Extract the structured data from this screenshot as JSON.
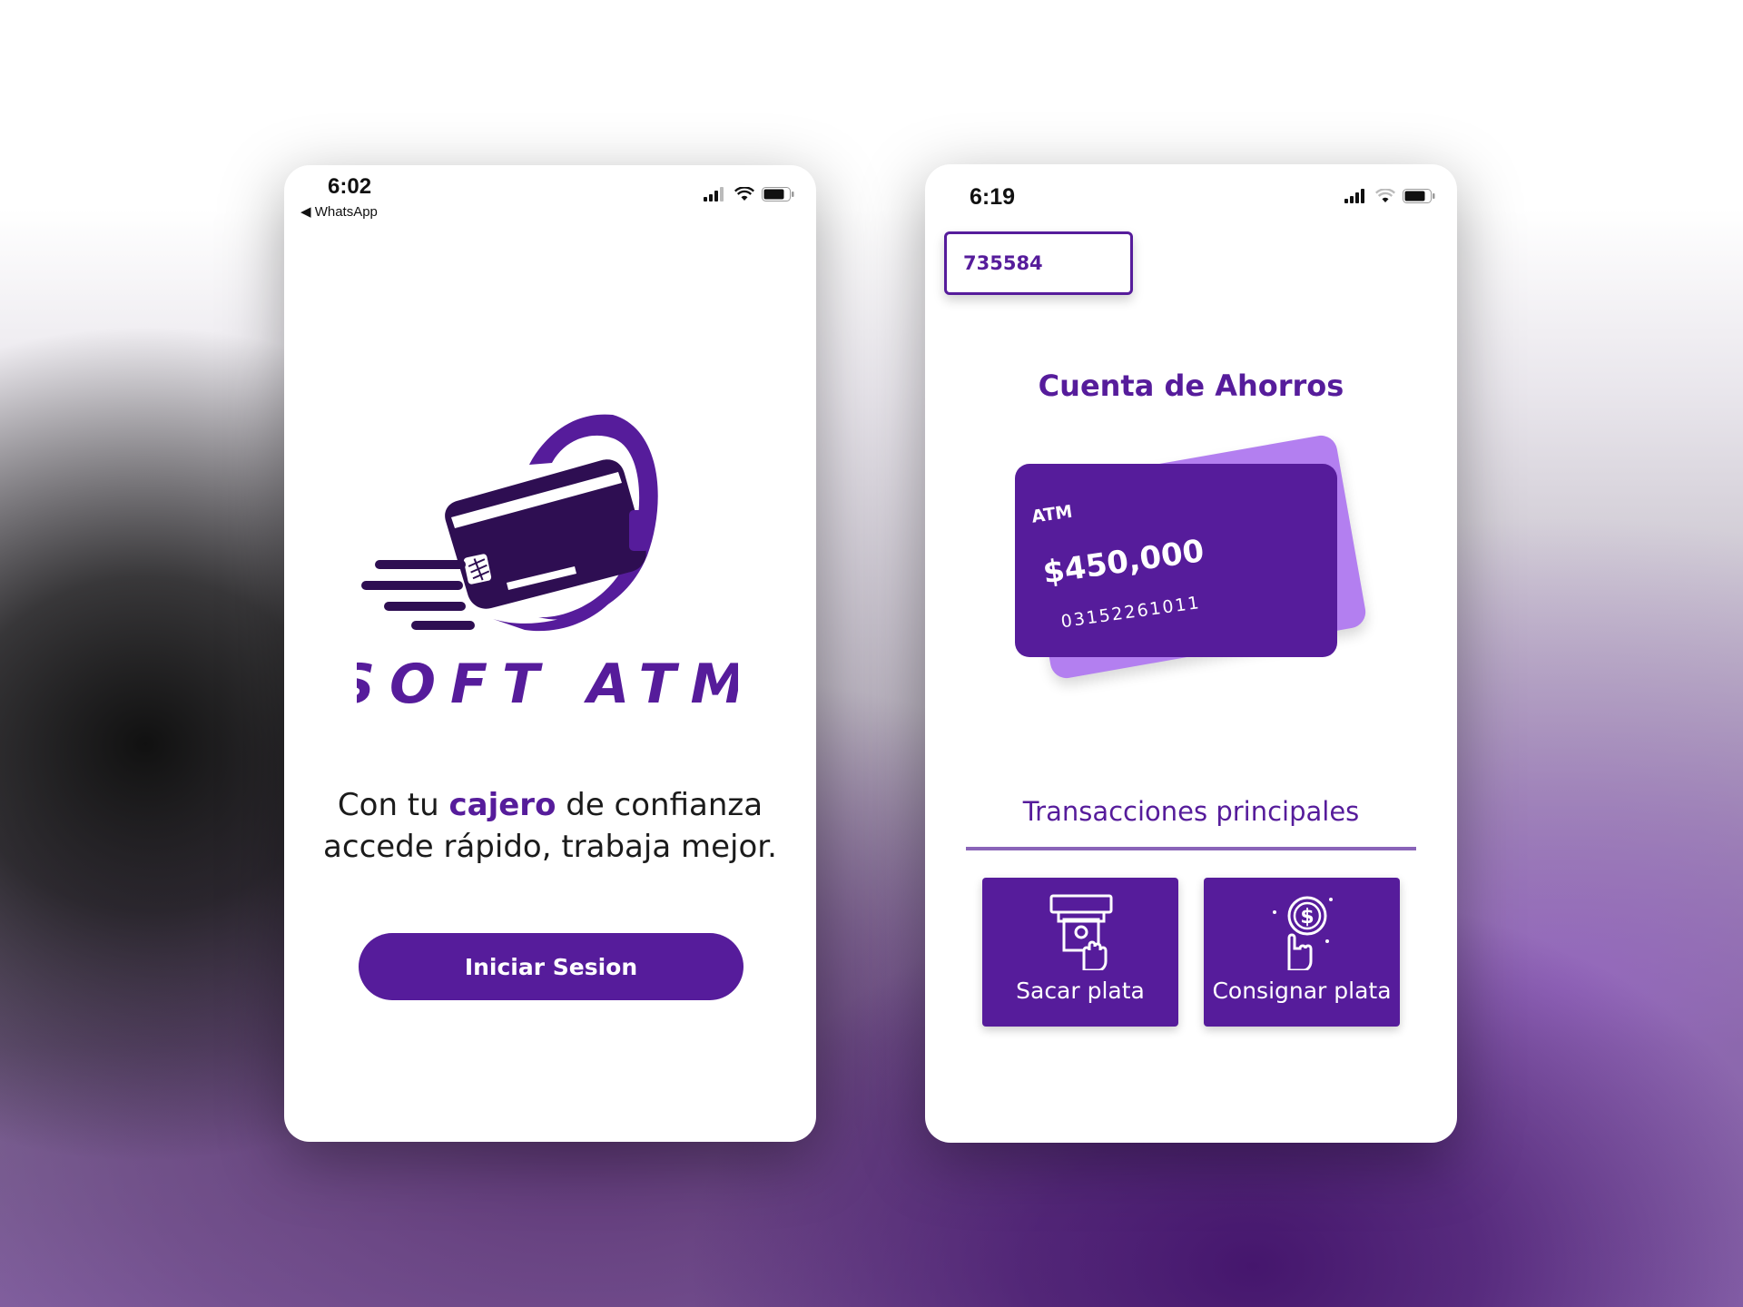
{
  "login_screen": {
    "status_bar": {
      "time": "6:02",
      "back_app": "◀ WhatsApp"
    },
    "brand": {
      "name": "SOFT ATM"
    },
    "tagline": {
      "part1": "Con tu ",
      "highlight": "cajero",
      "part2": " de confianza",
      "line2": "accede rápido, trabaja mejor."
    },
    "login_button": "Iniciar Sesion"
  },
  "account_screen": {
    "status_bar": {
      "time": "6:19"
    },
    "account_number": "735584",
    "title": "Cuenta de Ahorros",
    "card": {
      "brand": "ATM",
      "balance": "$450,000",
      "number": "03152261011"
    },
    "section_title": "Transacciones principales",
    "actions": [
      {
        "label": "Sacar plata",
        "icon": "atm-withdraw-icon"
      },
      {
        "label": "Consignar plata",
        "icon": "deposit-coin-icon"
      }
    ]
  },
  "colors": {
    "primary": "#561c9b",
    "card_back": "#b37ff0",
    "logo_dark": "#2e0e52"
  }
}
